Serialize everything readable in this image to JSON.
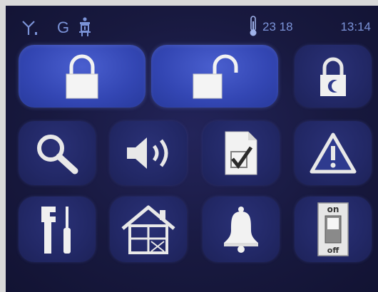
{
  "status_bar": {
    "gsm_label": "G",
    "temperature": "23 18",
    "time": "13:14"
  },
  "tiles": [
    {
      "name": "arm-lock",
      "icon": "lock-closed-icon"
    },
    {
      "name": "disarm-unlock",
      "icon": "lock-open-icon"
    },
    {
      "name": "night-arm",
      "icon": "lock-moon-icon"
    },
    {
      "name": "search",
      "icon": "magnifier-icon"
    },
    {
      "name": "volume",
      "icon": "speaker-icon"
    },
    {
      "name": "checklist",
      "icon": "document-check-icon"
    },
    {
      "name": "alarm-warning",
      "icon": "warning-triangle-icon"
    },
    {
      "name": "tools",
      "icon": "wrench-screwdriver-icon"
    },
    {
      "name": "house-zones",
      "icon": "house-icon"
    },
    {
      "name": "bell",
      "icon": "bell-icon"
    },
    {
      "name": "switch",
      "icon": "on-off-switch-icon"
    }
  ],
  "switch_labels": {
    "on": "on",
    "off": "off"
  },
  "colors": {
    "accent": "#3a4fc0",
    "screen_bg": "#18193f",
    "status_text": "#7b93d8"
  }
}
